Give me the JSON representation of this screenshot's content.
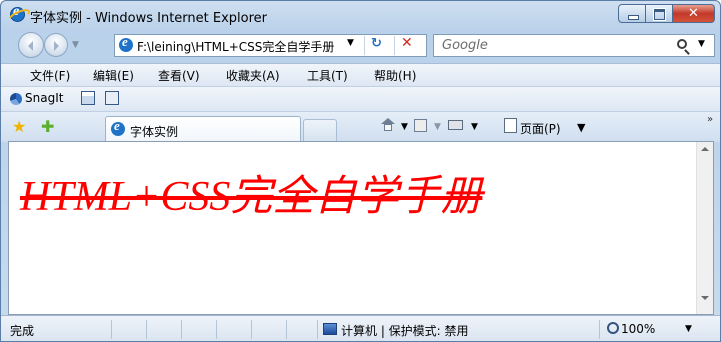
{
  "window": {
    "title": "字体实例 - Windows Internet Explorer",
    "controls": {
      "close": "✕"
    }
  },
  "address_bar": {
    "url": "F:\\leining\\HTML+CSS完全自学手册",
    "search_placeholder": "Google"
  },
  "menu": {
    "items": [
      {
        "label": "文件(F)"
      },
      {
        "label": "编辑(E)"
      },
      {
        "label": "查看(V)"
      },
      {
        "label": "收藏夹(A)"
      },
      {
        "label": "工具(T)"
      },
      {
        "label": "帮助(H)"
      }
    ]
  },
  "links_toolbar": {
    "snagit_label": "SnagIt"
  },
  "tabs": [
    {
      "label": "字体实例",
      "icon": "ie-page-icon",
      "active": true
    }
  ],
  "command_bar": {
    "page_label": "页面(P)",
    "overflow": "»"
  },
  "content": {
    "heading": "HTML+CSS完全自学手册",
    "heading_color": "#ff0000"
  },
  "status_bar": {
    "status": "完成",
    "zone": "计算机 | 保护模式: 禁用",
    "zoom": "100%"
  },
  "colors": {
    "window_border": "#5a7ea8",
    "close_button": "#c3392a",
    "accent": "#1e73c8"
  }
}
